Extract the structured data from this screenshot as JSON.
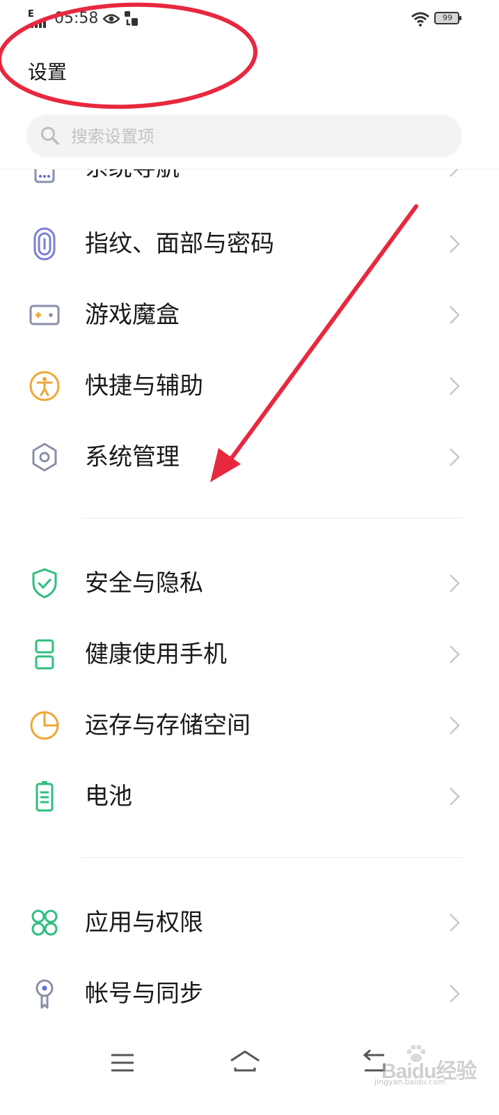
{
  "status_bar": {
    "network": "E",
    "time": "05:58",
    "battery": "99",
    "icons": [
      "signal-icon",
      "eye-icon",
      "nfc-icon",
      "wifi-icon",
      "battery-icon"
    ]
  },
  "header": {
    "title": "设置"
  },
  "search": {
    "placeholder": "搜索设置项"
  },
  "settings_items": [
    {
      "label": "系统导航",
      "icon": "navigation-icon",
      "color": "#8a8fa8"
    },
    {
      "label": "指纹、面部与密码",
      "icon": "fingerprint-icon",
      "color": "#7a7fd6"
    },
    {
      "label": "游戏魔盒",
      "icon": "gamepad-icon",
      "color": "#8a8fa8"
    },
    {
      "label": "快捷与辅助",
      "icon": "accessibility-icon",
      "color": "#f0a633"
    },
    {
      "label": "系统管理",
      "icon": "hexagon-icon",
      "color": "#8a8fa8"
    },
    {
      "label": "安全与隐私",
      "icon": "shield-icon",
      "color": "#2cbf7e"
    },
    {
      "label": "健康使用手机",
      "icon": "hourglass-icon",
      "color": "#2cbf7e"
    },
    {
      "label": "运存与存储空间",
      "icon": "pie-chart-icon",
      "color": "#f0a633"
    },
    {
      "label": "电池",
      "icon": "battery-icon",
      "color": "#2cbf7e"
    },
    {
      "label": "应用与权限",
      "icon": "apps-grid-icon",
      "color": "#2cbf7e"
    },
    {
      "label": "帐号与同步",
      "icon": "account-key-icon",
      "color": "#8a8fa8"
    }
  ],
  "nav_bar": {
    "icons": [
      "menu-icon",
      "home-icon",
      "back-icon"
    ]
  },
  "watermark": {
    "brand": "Baidu经验",
    "sub": "jingyan.baidu.com"
  },
  "annotation_color": "#e8283e"
}
